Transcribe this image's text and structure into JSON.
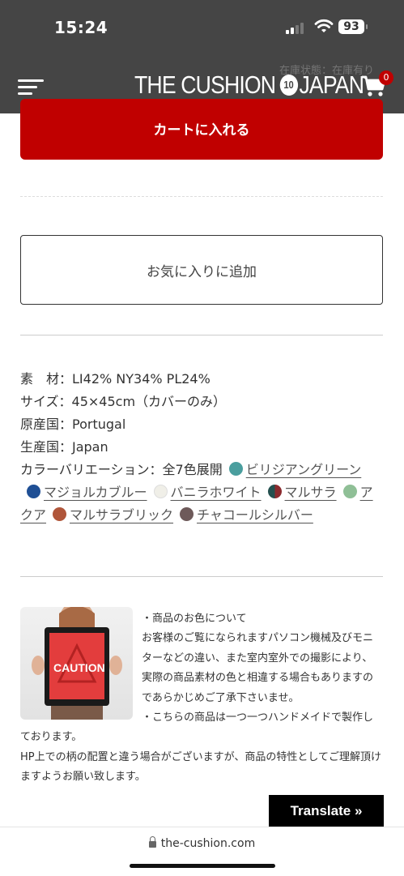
{
  "status_bar": {
    "time": "15:24",
    "battery": "93"
  },
  "header": {
    "logo_left": "THE CUSHION",
    "logo_badge": "10",
    "logo_right": "JAPAN",
    "stock_text": "在庫状態：在庫有り",
    "cart_count": "0"
  },
  "actions": {
    "add_to_cart": "カートに入れる",
    "add_favorite": "お気に入りに追加"
  },
  "specs": {
    "material": "素　材：LI42% NY34% PL24%",
    "size": "サイズ：45×45cm（カバーのみ）",
    "origin": "原産国：Portugal",
    "production": "生産国：Japan",
    "color_label": "カラーバリエーション：全7色展開"
  },
  "colors": [
    {
      "name": "ビリジアングリーン",
      "color": "#4a9e9e"
    },
    {
      "name": "マジョルカブルー",
      "color": "#1f4f95"
    },
    {
      "name": "バニラホワイト",
      "color": "#f0efe8"
    },
    {
      "name": "マルサラ",
      "color": "#8b2a2e",
      "secondary": "#24504f"
    },
    {
      "name": "アクア",
      "color": "#8fbf96"
    },
    {
      "name": "マルサラブリック",
      "color": "#b0563a"
    },
    {
      "name": "チャコールシルバー",
      "color": "#6e5a5a"
    }
  ],
  "notice": {
    "image_text": "CAUTION",
    "line1": "・商品のお色について",
    "line2": "お客様のご覧になられますパソコン機械及びモニターなどの違い、また室内室外での撮影により、実際の商品素材の色と相違する場合もありますのであらかじめご了承下さいませ。",
    "line3": "・こちらの商品は一つ一つハンドメイドで製作しております。",
    "line4": "HP上での柄の配置と違う場合がございますが、商品の特性としてご理解頂けますようお願い致します。"
  },
  "translate": {
    "label": "Translate »"
  },
  "browser": {
    "url": "the-cushion.com"
  }
}
